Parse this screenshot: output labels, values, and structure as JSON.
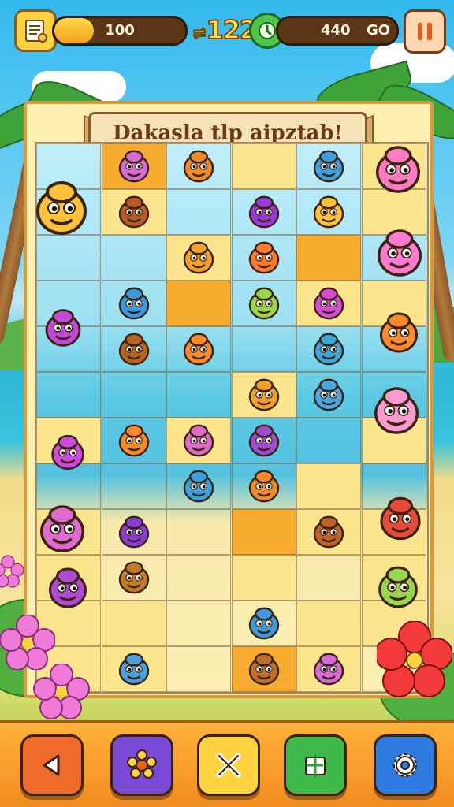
{
  "hud": {
    "progress_value": "100",
    "progress_fill": 0.3,
    "score": "122",
    "score_prefix": "≠",
    "timer_text": "40",
    "timer_prefix": "4",
    "timer_suffix": "GO"
  },
  "banner": {
    "title": "Dakasla tlp aipztab!"
  },
  "colors": {
    "orange_tile": "#f7ab2f",
    "yellow_tile": "#fde58d",
    "toolbar": "#f5a02a",
    "frame": "#d99a3c"
  },
  "grid": {
    "rows": 12,
    "cols": 6
  },
  "toolbar": {
    "buttons": [
      {
        "name": "back-button",
        "icon": "back-arrow-icon",
        "color": "#f06a2a"
      },
      {
        "name": "hint-button",
        "icon": "gear-flower-icon",
        "color": "#7a4ad6"
      },
      {
        "name": "shuffle-button",
        "icon": "x-icon",
        "color": "#ffd23f"
      },
      {
        "name": "puzzle-button",
        "icon": "puzzle-piece-icon",
        "color": "#3fb94a"
      },
      {
        "name": "settings-button",
        "icon": "gear-icon",
        "color": "#2f7ae0"
      }
    ]
  },
  "critters": [
    {
      "id": "pink-squid",
      "row": 0,
      "col": 1,
      "color": "#d86ad8"
    },
    {
      "id": "orange-fox",
      "row": 0,
      "col": 2,
      "color": "#f08a2a"
    },
    {
      "id": "blue-bucket",
      "row": 0,
      "col": 4,
      "color": "#3aa0e0"
    },
    {
      "id": "brown-bear",
      "row": 1,
      "col": 1,
      "color": "#b85a22"
    },
    {
      "id": "purple-ghost",
      "row": 1,
      "col": 3,
      "color": "#9a3ad6"
    },
    {
      "id": "yellow-shell",
      "row": 1,
      "col": 4,
      "color": "#ffc13a"
    },
    {
      "id": "orange-bird",
      "row": 2,
      "col": 2,
      "color": "#f2a22a"
    },
    {
      "id": "orange-blob",
      "row": 2,
      "col": 3,
      "color": "#ff7a2a"
    },
    {
      "id": "blue-fish",
      "row": 3,
      "col": 1,
      "color": "#3a9ae0"
    },
    {
      "id": "green-frog",
      "row": 3,
      "col": 3,
      "color": "#9ad64a"
    },
    {
      "id": "sea-cucumber",
      "row": 3,
      "col": 4,
      "color": "#d64ad6"
    },
    {
      "id": "brown-octopus",
      "row": 4,
      "col": 1,
      "color": "#b8641e"
    },
    {
      "id": "orange-fruit",
      "row": 4,
      "col": 2,
      "color": "#ff8a2a"
    },
    {
      "id": "blue-whale",
      "row": 4,
      "col": 4,
      "color": "#3aa8e0"
    },
    {
      "id": "orange-monkey",
      "row": 5,
      "col": 3,
      "color": "#f2a22a"
    },
    {
      "id": "blue-pufferfish",
      "row": 5,
      "col": 4,
      "color": "#4aa8e0"
    },
    {
      "id": "orange-crab",
      "row": 6,
      "col": 1,
      "color": "#ff8a2a"
    },
    {
      "id": "pink-hippo",
      "row": 6,
      "col": 2,
      "color": "#e06ad0"
    },
    {
      "id": "purple-squid",
      "row": 6,
      "col": 3,
      "color": "#a04ad6"
    },
    {
      "id": "blue-shark",
      "row": 7,
      "col": 2,
      "color": "#3aa0e0"
    },
    {
      "id": "orange-owl",
      "row": 7,
      "col": 3,
      "color": "#f28a2a"
    },
    {
      "id": "purple-blob",
      "row": 8,
      "col": 1,
      "color": "#8a3ad6"
    },
    {
      "id": "brown-horse",
      "row": 8,
      "col": 4,
      "color": "#c0602a"
    },
    {
      "id": "brown-dino",
      "row": 9,
      "col": 1,
      "color": "#c07a2a"
    },
    {
      "id": "blue-dolphin",
      "row": 10,
      "col": 3,
      "color": "#3a9ae0"
    },
    {
      "id": "blue-seal",
      "row": 11,
      "col": 1,
      "color": "#4aa0e0"
    },
    {
      "id": "brown-bear-2",
      "row": 11,
      "col": 3,
      "color": "#c0702a"
    },
    {
      "id": "purple-radish",
      "row": 11,
      "col": 4,
      "color": "#d66ad6"
    }
  ],
  "side_critters": [
    {
      "id": "yellow-cow",
      "color": "#ffc13a"
    },
    {
      "id": "pink-face",
      "color": "#ff7ac0"
    },
    {
      "id": "purple-box",
      "color": "#c04ad6"
    },
    {
      "id": "pink-bunny",
      "color": "#ff7ad0"
    },
    {
      "id": "orange-apple",
      "color": "#ff8a2a"
    },
    {
      "id": "pink-pig",
      "color": "#ff9ad0"
    },
    {
      "id": "purple-cube",
      "color": "#d04ae0"
    },
    {
      "id": "pink-lady",
      "color": "#e06ad0"
    },
    {
      "id": "red-strawberry",
      "color": "#e84a3a"
    },
    {
      "id": "purple-grape",
      "color": "#b04ad6"
    },
    {
      "id": "green-fish",
      "color": "#9ad64a"
    }
  ]
}
